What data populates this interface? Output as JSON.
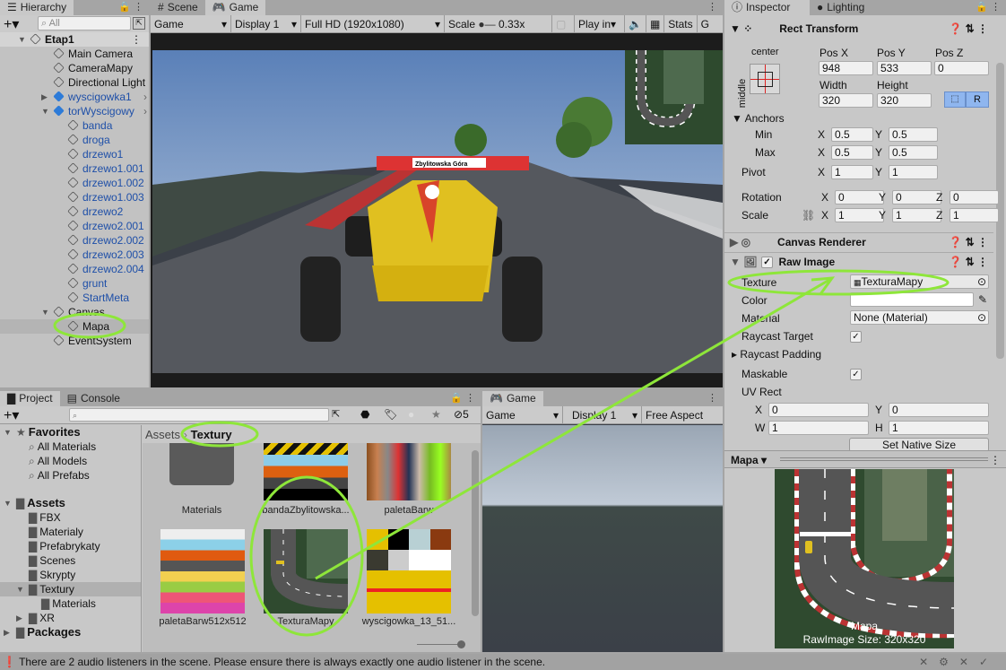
{
  "hierarchy": {
    "tab": "Hierarchy",
    "search_placeholder": "All",
    "items": [
      {
        "label": "Etap1",
        "depth": 0,
        "arrow": "▼",
        "bold": true,
        "blue": false
      },
      {
        "label": "Main Camera",
        "depth": 1,
        "arrow": "",
        "blue": false
      },
      {
        "label": "CameraMapy",
        "depth": 1,
        "arrow": "",
        "blue": false
      },
      {
        "label": "Directional Light",
        "depth": 1,
        "arrow": "",
        "blue": false
      },
      {
        "label": "wyscigowka1",
        "depth": 1,
        "arrow": "▶",
        "blue": true
      },
      {
        "label": "torWyscigowy",
        "depth": 1,
        "arrow": "▼",
        "blue": true
      },
      {
        "label": "banda",
        "depth": 2,
        "arrow": "",
        "blue": true
      },
      {
        "label": "droga",
        "depth": 2,
        "arrow": "",
        "blue": true
      },
      {
        "label": "drzewo1",
        "depth": 2,
        "arrow": "",
        "blue": true
      },
      {
        "label": "drzewo1.001",
        "depth": 2,
        "arrow": "",
        "blue": true
      },
      {
        "label": "drzewo1.002",
        "depth": 2,
        "arrow": "",
        "blue": true
      },
      {
        "label": "drzewo1.003",
        "depth": 2,
        "arrow": "",
        "blue": true
      },
      {
        "label": "drzewo2",
        "depth": 2,
        "arrow": "",
        "blue": true
      },
      {
        "label": "drzewo2.001",
        "depth": 2,
        "arrow": "",
        "blue": true
      },
      {
        "label": "drzewo2.002",
        "depth": 2,
        "arrow": "",
        "blue": true
      },
      {
        "label": "drzewo2.003",
        "depth": 2,
        "arrow": "",
        "blue": true
      },
      {
        "label": "drzewo2.004",
        "depth": 2,
        "arrow": "",
        "blue": true
      },
      {
        "label": "grunt",
        "depth": 2,
        "arrow": "",
        "blue": true
      },
      {
        "label": "StartMeta",
        "depth": 2,
        "arrow": "",
        "blue": true
      },
      {
        "label": "Canvas",
        "depth": 1,
        "arrow": "▼",
        "blue": false
      },
      {
        "label": "Mapa",
        "depth": 2,
        "arrow": "",
        "blue": false,
        "selected": true
      },
      {
        "label": "EventSystem",
        "depth": 1,
        "arrow": "",
        "blue": false
      }
    ]
  },
  "game": {
    "tabs": [
      "Scene",
      "Game"
    ],
    "toolbar": {
      "mode": "Game",
      "display": "Display 1",
      "resolution": "Full HD (1920x1080)",
      "scale_label": "Scale",
      "scale_value": "0.33x",
      "play": "Play in",
      "stats": "Stats",
      "gizmos": "G"
    },
    "sign_text": "Zbylitowska Góra"
  },
  "inspector": {
    "tabs": [
      "Inspector",
      "Lighting"
    ],
    "rect_transform": {
      "title": "Rect Transform",
      "anchor_h": "center",
      "anchor_v": "middle",
      "pos_x_label": "Pos X",
      "pos_y_label": "Pos Y",
      "pos_z_label": "Pos Z",
      "pos_x": "948",
      "pos_y": "533",
      "pos_z": "0",
      "width_label": "Width",
      "height_label": "Height",
      "width": "320",
      "height": "320",
      "raw_btn": "R",
      "anchors_label": "Anchors",
      "min_label": "Min",
      "max_label": "Max",
      "min_x": "0.5",
      "min_y": "0.5",
      "max_x": "0.5",
      "max_y": "0.5",
      "pivot_label": "Pivot",
      "pivot_x": "1",
      "pivot_y": "1",
      "rotation_label": "Rotation",
      "rot_x": "0",
      "rot_y": "0",
      "rot_z": "0",
      "scale_label": "Scale",
      "scale_x": "1",
      "scale_y": "1",
      "scale_z": "1",
      "x": "X",
      "y": "Y",
      "z": "Z"
    },
    "canvas_renderer": {
      "title": "Canvas Renderer"
    },
    "raw_image": {
      "title": "Raw Image",
      "enabled": true,
      "texture_label": "Texture",
      "texture_value": "TexturaMapy",
      "color_label": "Color",
      "color_value": "#ffffff",
      "material_label": "Material",
      "material_value": "None (Material)",
      "raycast_target_label": "Raycast Target",
      "raycast_target": true,
      "raycast_padding_label": "Raycast Padding",
      "maskable_label": "Maskable",
      "maskable": true,
      "uv_rect_label": "UV Rect",
      "uv_x": "0",
      "uv_y": "0",
      "uv_w": "1",
      "uv_h": "1",
      "w": "W",
      "h": "H",
      "native_size_btn": "Set Native Size"
    },
    "preview": {
      "object": "Mapa",
      "name": "Mapa",
      "size_text": "RawImage Size: 320x320"
    }
  },
  "project": {
    "tabs": [
      "Project",
      "Console"
    ],
    "hidden_count": "5",
    "breadcrumb": [
      "Assets",
      "Textury"
    ],
    "favorites": {
      "label": "Favorites",
      "items": [
        "All Materials",
        "All Models",
        "All Prefabs"
      ]
    },
    "assets": {
      "label": "Assets",
      "folders": [
        "FBX",
        "Materialy",
        "Prefabrykaty",
        "Scenes",
        "Skrypty",
        "Textury"
      ],
      "sub": "Materials"
    },
    "packages": "Packages",
    "xr": "XR",
    "grid": [
      "Materials",
      "bandaZbylitowska...",
      "paletaBarw",
      "paletaBarw512x512",
      "TexturaMapy",
      "wyscigowka_13_51..."
    ]
  },
  "game2": {
    "tab": "Game",
    "mode": "Game",
    "display": "Display 1",
    "aspect": "Free Aspect"
  },
  "status": {
    "message": "There are 2 audio listeners in the scene. Please ensure there is always exactly one audio listener in the scene."
  },
  "colors": {
    "annotation": "#8ee63a",
    "selection": "#8fb6ef",
    "prefab_blue": "#1e4fa8"
  }
}
